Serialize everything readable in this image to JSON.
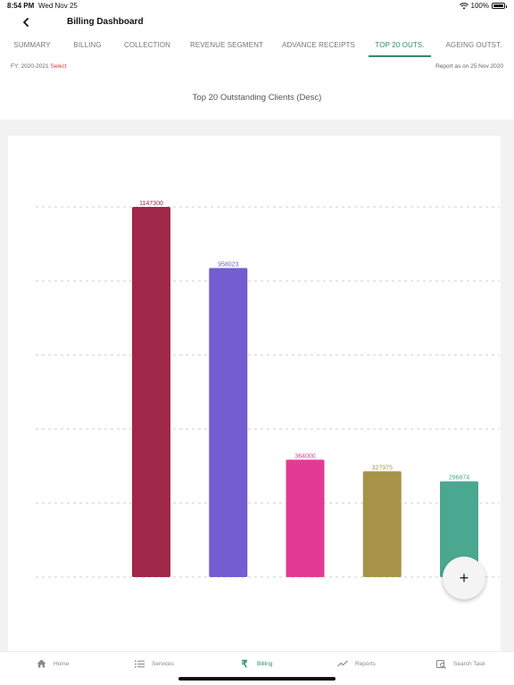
{
  "status": {
    "time": "8:54 PM",
    "date": "Wed Nov 25",
    "battery": "100%"
  },
  "header": {
    "title": "Billing Dashboard"
  },
  "tabs": [
    {
      "label": "SUMMARY",
      "active": false
    },
    {
      "label": "BILLING",
      "active": false
    },
    {
      "label": "COLLECTION",
      "active": false
    },
    {
      "label": "REVENUE SEGMENT",
      "active": false
    },
    {
      "label": "ADVANCE RECEIPTS",
      "active": false
    },
    {
      "label": "TOP 20 OUTS.",
      "active": true
    },
    {
      "label": "AGEING OUTST.",
      "active": false
    }
  ],
  "filter": {
    "fy_label": "FY: 2020-2021",
    "select_label": "Select",
    "report_date": "Report as on 25 Nov 2020"
  },
  "chart_title": "Top 20 Outstanding Clients (Desc)",
  "chart_data": {
    "type": "bar",
    "title": "Top 20 Outstanding Clients (Desc)",
    "categories": [
      "",
      "",
      "",
      "",
      ""
    ],
    "values": [
      1147300,
      958023,
      364000,
      327975,
      296874
    ],
    "colors": [
      "#a0284a",
      "#735ed1",
      "#e23b95",
      "#a79448",
      "#4aa891"
    ],
    "label_colors": [
      "#a0284a",
      "#735ed1",
      "#e23b95",
      "#a79448",
      "#4aa891"
    ],
    "ylim": [
      0,
      1147300
    ],
    "grid": true,
    "xlabel": "",
    "ylabel": ""
  },
  "fab": {
    "label": "+"
  },
  "nav": {
    "home": "Home",
    "services": "Services",
    "billing": "Billing",
    "reports": "Reports",
    "search_task": "Search Task",
    "rupee_glyph": "₹"
  },
  "accent_color": "#2e8b6e"
}
